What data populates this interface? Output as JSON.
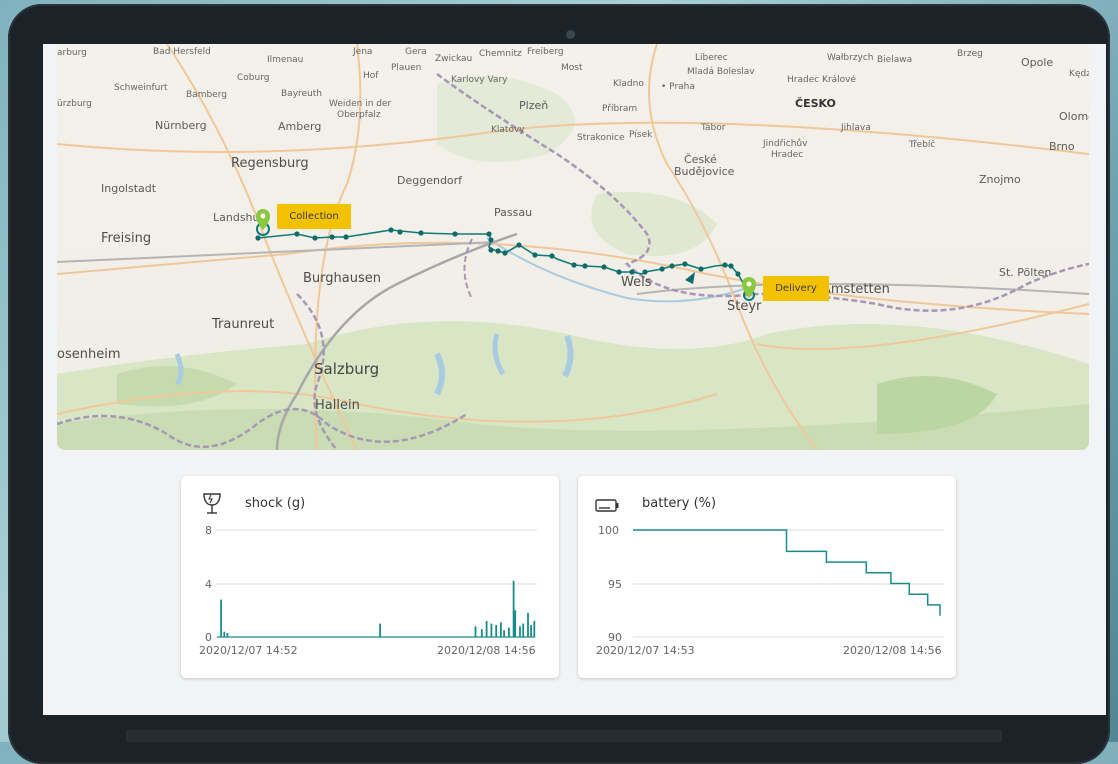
{
  "map": {
    "labels": [
      {
        "key": "arburg",
        "text": "arburg"
      },
      {
        "key": "bad_hersfeld",
        "text": "Bad Hersfeld"
      },
      {
        "key": "ilmenau",
        "text": "Ilmenau"
      },
      {
        "key": "jena",
        "text": "Jena"
      },
      {
        "key": "gera",
        "text": "Gera"
      },
      {
        "key": "zwickau",
        "text": "Zwickau"
      },
      {
        "key": "chemnitz",
        "text": "Chemnitz"
      },
      {
        "key": "freiberg",
        "text": "Freiberg"
      },
      {
        "key": "liberec",
        "text": "Liberec"
      },
      {
        "key": "walbrzych",
        "text": "Wałbrzych"
      },
      {
        "key": "bielawa",
        "text": "Bielawa"
      },
      {
        "key": "brzeg",
        "text": "Brzeg"
      },
      {
        "key": "opole",
        "text": "Opole"
      },
      {
        "key": "kedz",
        "text": "Kędz"
      },
      {
        "key": "plauen",
        "text": "Plauen"
      },
      {
        "key": "most",
        "text": "Most"
      },
      {
        "key": "mlada",
        "text": "Mladá Boleslav"
      },
      {
        "key": "schweinfurt",
        "text": "Schweinfurt"
      },
      {
        "key": "coburg",
        "text": "Coburg"
      },
      {
        "key": "hof",
        "text": "Hof"
      },
      {
        "key": "karlovy",
        "text": "Karlovy Vary"
      },
      {
        "key": "kladno",
        "text": "Kladno"
      },
      {
        "key": "praha",
        "text": "• Praha"
      },
      {
        "key": "hradec",
        "text": "Hradec Králové"
      },
      {
        "key": "urzburg",
        "text": "ürzburg"
      },
      {
        "key": "bamberg",
        "text": "Bamberg"
      },
      {
        "key": "bayreuth",
        "text": "Bayreuth"
      },
      {
        "key": "weiden",
        "text": "Weiden in der"
      },
      {
        "key": "oberpfalz",
        "text": "Oberpfalz"
      },
      {
        "key": "plzen",
        "text": "Plzeň"
      },
      {
        "key": "pribram",
        "text": "Příbram"
      },
      {
        "key": "cesko",
        "text": "ČESKO"
      },
      {
        "key": "olomo",
        "text": "Olomo"
      },
      {
        "key": "nurnberg",
        "text": "Nürnberg"
      },
      {
        "key": "amberg",
        "text": "Amberg"
      },
      {
        "key": "klatovy",
        "text": "Klatovy"
      },
      {
        "key": "strakonice",
        "text": "Strakonice"
      },
      {
        "key": "pisek",
        "text": "Písek"
      },
      {
        "key": "tabor",
        "text": "Tábor"
      },
      {
        "key": "jihlava",
        "text": "Jihlava"
      },
      {
        "key": "jindrichuv",
        "text": "Jindřichův"
      },
      {
        "key": "jhradec",
        "text": "Hradec"
      },
      {
        "key": "trebic",
        "text": "Třebíč"
      },
      {
        "key": "brno",
        "text": "Brno"
      },
      {
        "key": "regensburg",
        "text": "Regensburg"
      },
      {
        "key": "ceske",
        "text": "České"
      },
      {
        "key": "budejovice",
        "text": "Budějovice"
      },
      {
        "key": "ingolstadt",
        "text": "Ingolstadt"
      },
      {
        "key": "deggendorf",
        "text": "Deggendorf"
      },
      {
        "key": "znojmo",
        "text": "Znojmo"
      },
      {
        "key": "landshut",
        "text": "Landshut"
      },
      {
        "key": "passau",
        "text": "Passau"
      },
      {
        "key": "freising",
        "text": "Freising"
      },
      {
        "key": "st_polten",
        "text": "St. Pölten"
      },
      {
        "key": "burghausen",
        "text": "Burghausen"
      },
      {
        "key": "wels",
        "text": "Wels"
      },
      {
        "key": "amstetten",
        "text": "Amstetten"
      },
      {
        "key": "steyr",
        "text": "Steyr"
      },
      {
        "key": "traunreut",
        "text": "Traunreut"
      },
      {
        "key": "rosenheim",
        "text": "osenheim"
      },
      {
        "key": "salzburg",
        "text": "Salzburg"
      },
      {
        "key": "hallein",
        "text": "Hallein"
      }
    ],
    "collection_label": "Collection",
    "delivery_label": "Delivery",
    "route_color": "#0f7a7a",
    "marker_color": "#8ac83f"
  },
  "shock_card": {
    "title": "shock (g)",
    "icon": "fragile-glass-icon",
    "y_ticks": [
      "8",
      "4",
      "0"
    ],
    "start_date": "2020/12/07 14:52",
    "end_date": "2020/12/08 14:56",
    "color": "#1a8a8a"
  },
  "battery_card": {
    "title": "battery (%)",
    "icon": "battery-icon",
    "y_ticks": [
      "100",
      "95",
      "90"
    ],
    "start_date": "2020/12/07 14:53",
    "end_date": "2020/12/08 14:56",
    "color": "#1a8a8a"
  },
  "chart_data": [
    {
      "type": "bar",
      "title": "shock (g)",
      "ylim": [
        0,
        8
      ],
      "x_range": [
        "2020/12/07 14:52",
        "2020/12/08 14:56"
      ],
      "values": [
        2.8,
        0.4,
        0.3,
        1.0,
        0.8,
        0.6,
        1.2,
        1.0,
        0.9,
        1.1,
        0.5,
        0.7,
        4.2,
        2.0,
        0.8,
        1.0,
        1.8,
        0.9,
        1.2
      ]
    },
    {
      "type": "line",
      "title": "battery (%)",
      "ylim": [
        90,
        100
      ],
      "x_range": [
        "2020/12/07 14:53",
        "2020/12/08 14:56"
      ],
      "values": [
        100,
        100,
        98,
        98,
        97,
        97,
        96,
        95,
        94,
        93,
        92
      ]
    }
  ]
}
